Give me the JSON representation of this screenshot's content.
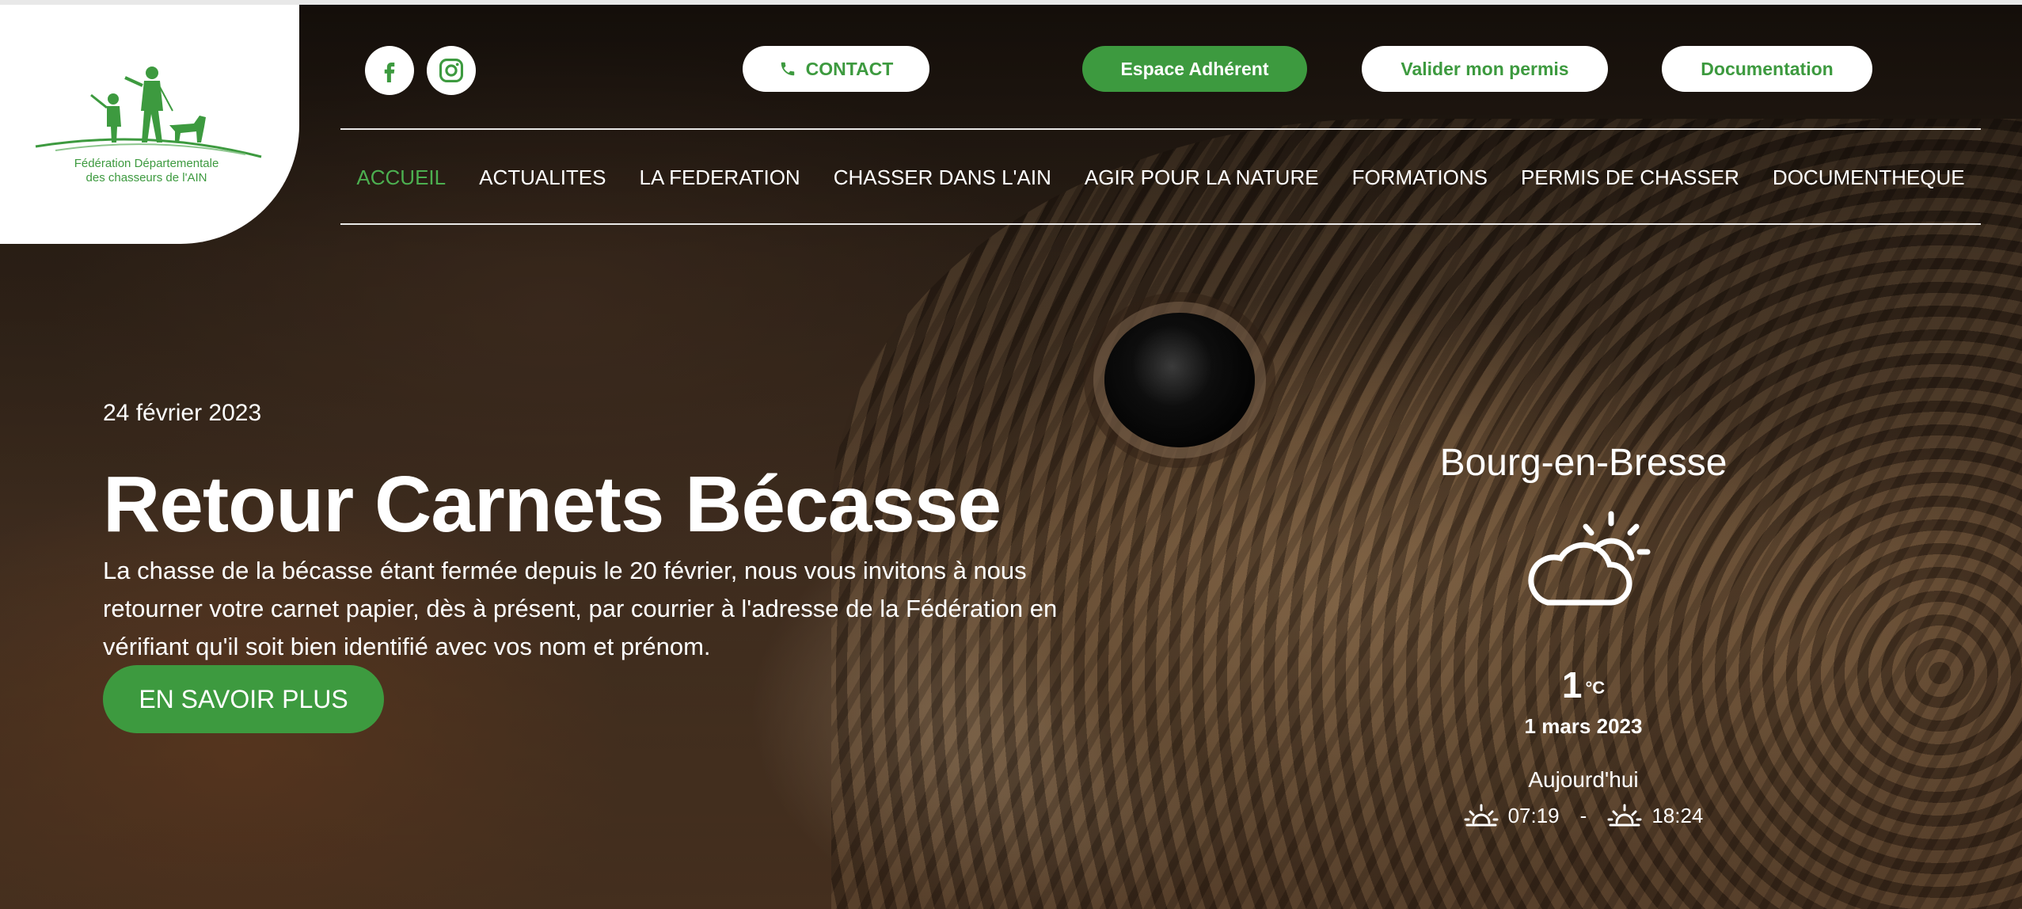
{
  "header": {
    "logo": {
      "line1": "Fédération Départementale",
      "line2": "des chasseurs de l'AIN"
    },
    "social": [
      {
        "icon": "facebook-icon"
      },
      {
        "icon": "instagram-icon"
      }
    ],
    "buttons": {
      "contact": "CONTACT",
      "member_area": "Espace Adhérent",
      "validate_permit": "Valider mon permis",
      "documentation": "Documentation"
    },
    "nav": [
      {
        "label": "ACCUEIL",
        "active": true
      },
      {
        "label": "ACTUALITES"
      },
      {
        "label": "LA FEDERATION"
      },
      {
        "label": "CHASSER DANS L'AIN"
      },
      {
        "label": "AGIR POUR LA NATURE"
      },
      {
        "label": "FORMATIONS"
      },
      {
        "label": "PERMIS DE CHASSER"
      },
      {
        "label": "DOCUMENTHEQUE"
      }
    ]
  },
  "slide": {
    "date": "24 février 2023",
    "title": "Retour Carnets Bécasse",
    "description": "La chasse de la bécasse étant fermée depuis le 20 février, nous vous invitons à nous retourner votre carnet papier, dès à présent, par courrier à l'adresse de la Fédération en vérifiant qu'il soit bien identifié avec vos nom et prénom.",
    "cta": "EN SAVOIR PLUS"
  },
  "weather": {
    "city": "Bourg-en-Bresse",
    "icon": "partly-cloudy-icon",
    "temperature": "1",
    "unit": "°C",
    "date": "1 mars 2023",
    "today_label": "Aujourd'hui",
    "sunrise": "07:19",
    "separator": "-",
    "sunset": "18:24"
  },
  "colors": {
    "brand_green": "#3d9a3f",
    "active_nav": "#4caf50"
  }
}
